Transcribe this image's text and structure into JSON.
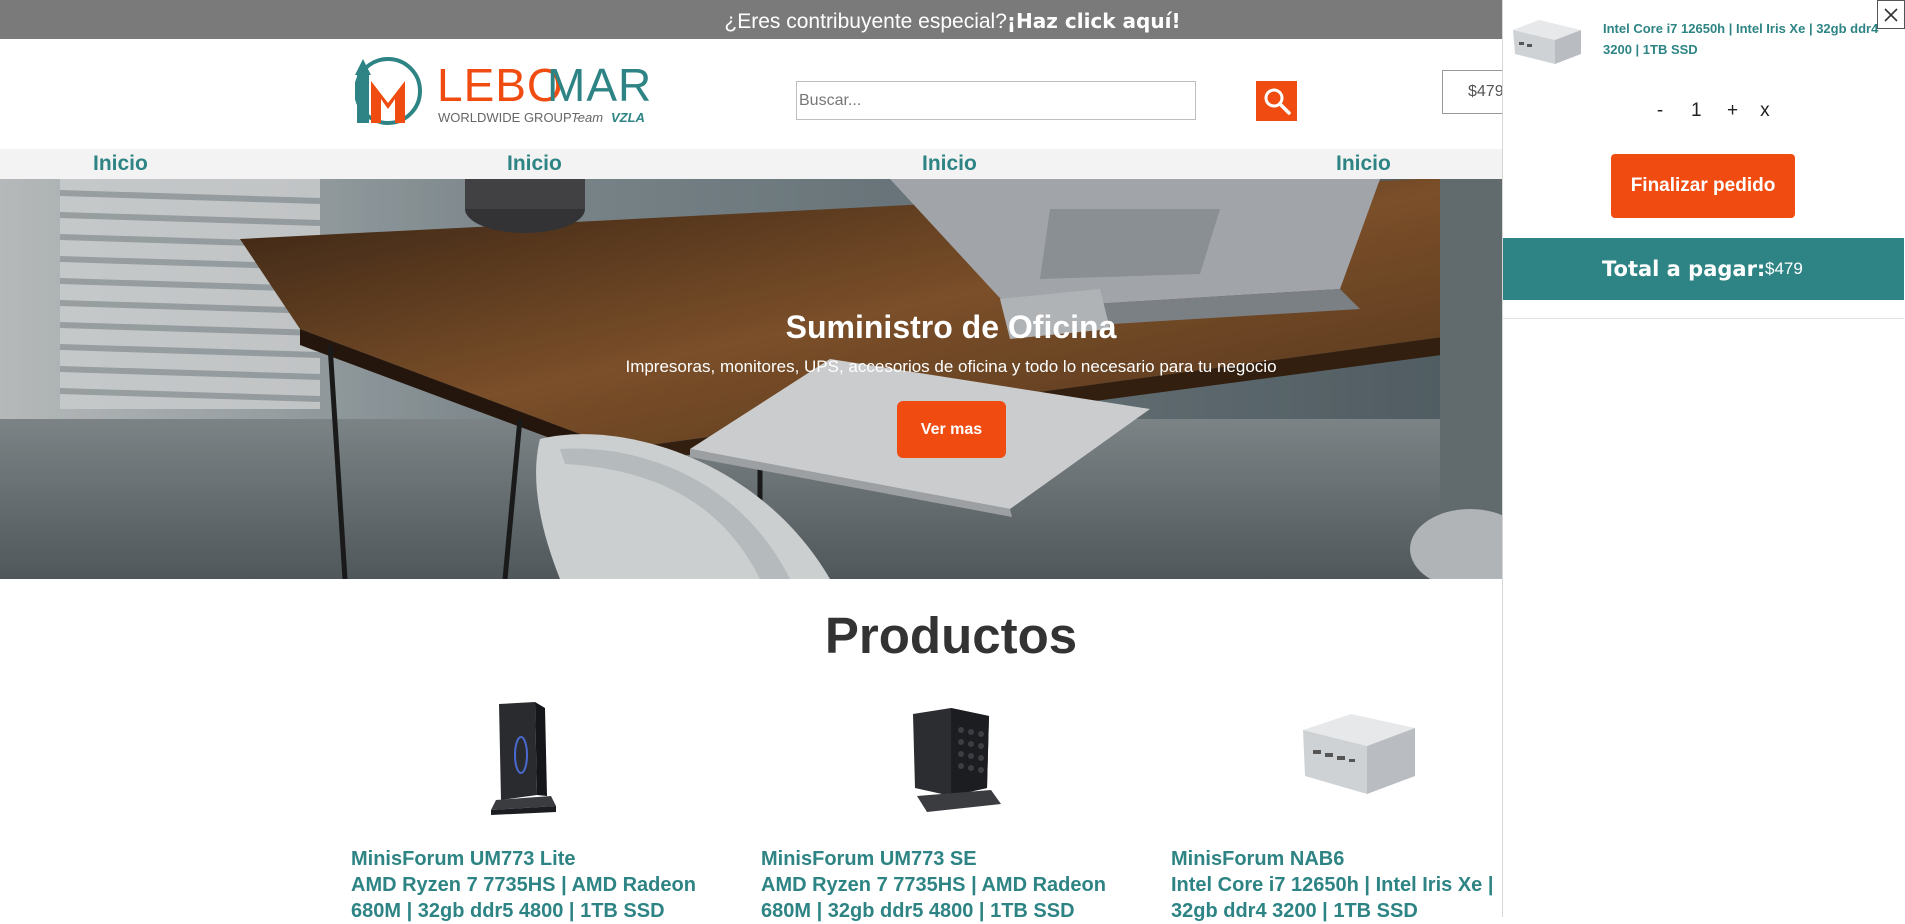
{
  "promo": {
    "question": "¿Eres contribuyente especial?",
    "cta": "¡Haz click aquí!"
  },
  "header": {
    "logo": {
      "wordmark_a": "LEBO",
      "wordmark_b": "MAR",
      "tagline_a": "WORLDWIDE GROUP · ",
      "tagline_b": "Team ",
      "tagline_c": "VZLA"
    },
    "search": {
      "placeholder": "Buscar..."
    },
    "cart_total": "$479"
  },
  "nav": {
    "items": [
      {
        "label": "Inicio"
      },
      {
        "label": "Inicio"
      },
      {
        "label": "Inicio"
      },
      {
        "label": "Inicio"
      }
    ]
  },
  "hero": {
    "title": "Suministro de Oficina",
    "subtitle": "Impresoras, monitores, UPS, accesorios de oficina y todo lo necesario para tu negocio",
    "button": "Ver mas"
  },
  "products": {
    "title": "Productos",
    "items": [
      {
        "name": "MinisForum UM773 Lite",
        "desc": "AMD Ryzen 7 7735HS | AMD Radeon 680M | 32gb ddr5 4800 | 1TB SSD"
      },
      {
        "name": "MinisForum UM773 SE",
        "desc": "AMD Ryzen 7 7735HS | AMD Radeon 680M | 32gb ddr5 4800 | 1TB SSD"
      },
      {
        "name": "MinisForum NAB6",
        "desc": "Intel Core i7 12650h | Intel Iris Xe | 32gb ddr4 3200 | 1TB SSD"
      }
    ]
  },
  "cart": {
    "close": "×",
    "item": {
      "title": "Intel Core i7 12650h | Intel Iris Xe | 32gb ddr4 3200 | 1TB SSD",
      "quantity": "1"
    },
    "controls": {
      "minus": "-",
      "plus": "+",
      "remove": "x"
    },
    "checkout": "Finalizar pedido",
    "total_label": "Total a pagar:",
    "total_value": "$479"
  },
  "colors": {
    "accent": "#f04c12",
    "brand_teal": "#2e8484",
    "promo_bg": "#7a7a7a"
  }
}
